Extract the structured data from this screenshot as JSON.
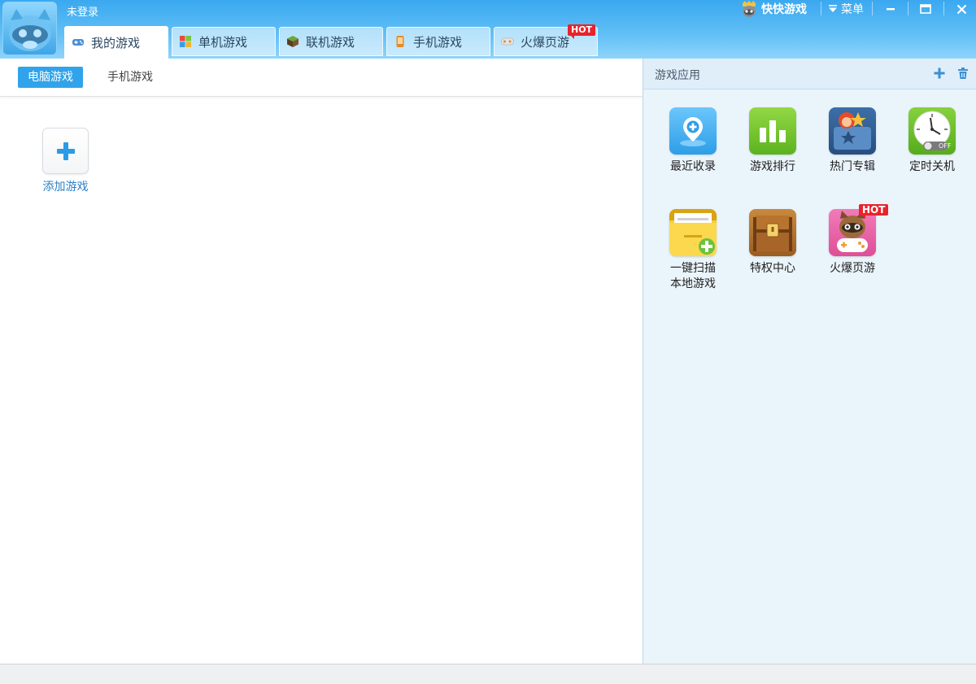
{
  "header": {
    "login_status": "未登录",
    "brand_name": "快快游戏",
    "menu_label": "菜单",
    "tabs": [
      {
        "label": "我的游戏",
        "active": true
      },
      {
        "label": "单机游戏",
        "active": false
      },
      {
        "label": "联机游戏",
        "active": false
      },
      {
        "label": "手机游戏",
        "active": false
      },
      {
        "label": "火爆页游",
        "active": false,
        "badge": "HOT"
      }
    ]
  },
  "subtabs": [
    {
      "label": "电脑游戏",
      "active": true
    },
    {
      "label": "手机游戏",
      "active": false
    }
  ],
  "my_games": {
    "add_label": "添加游戏"
  },
  "apps_panel": {
    "title": "游戏应用",
    "items": [
      {
        "label": "最近收录",
        "icon": "pin-plus-icon"
      },
      {
        "label": "游戏排行",
        "icon": "bar-chart-icon"
      },
      {
        "label": "热门专辑",
        "icon": "album-icon"
      },
      {
        "label": "定时关机",
        "icon": "clock-icon",
        "icon_text": "OFF"
      },
      {
        "label_line1": "一键扫描",
        "label_line2": "本地游戏",
        "icon": "folder-plus-icon"
      },
      {
        "label": "特权中心",
        "icon": "treasure-chest-icon"
      },
      {
        "label": "火爆页游",
        "icon": "raccoon-gamepad-icon",
        "badge": "HOT"
      }
    ]
  },
  "colors": {
    "header_top": "#3aa8f0",
    "accent": "#31a3ea",
    "panel_bg": "#eaf4fb",
    "hot": "#e8232b"
  }
}
